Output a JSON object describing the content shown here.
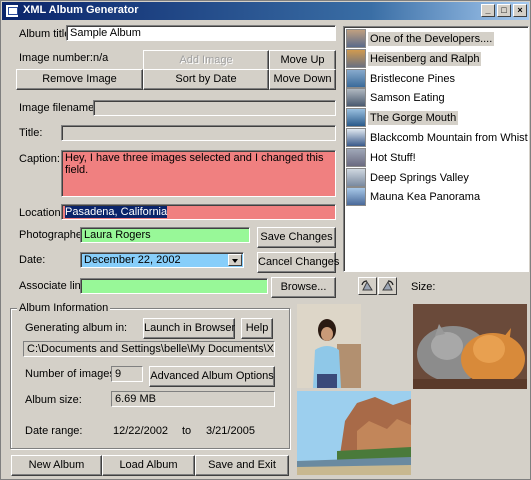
{
  "window": {
    "title": "XML Album Generator",
    "controls": {
      "minimize": "_",
      "maximize": "□",
      "close": "×"
    }
  },
  "form": {
    "album_title_label": "Album title:",
    "album_title_value": "Sample Album",
    "image_number_label": "Image number:",
    "image_number_value": "n/a",
    "image_filename_label": "Image filename:",
    "image_filename_value": "",
    "title_label": "Title:",
    "title_value": "",
    "caption_label": "Caption:",
    "caption_value": "Hey, I have three images selected and I changed this field.",
    "location_label": "Location:",
    "location_value": "Pasadena, California",
    "photographer_label": "Photographer:",
    "photographer_value": "Laura Rogers",
    "date_label": "Date:",
    "date_value": "December 22, 2002",
    "associate_link_label": "Associate link:",
    "associate_link_value": "",
    "size_label": "Size:"
  },
  "buttons": {
    "add_image": "Add Image",
    "move_up": "Move Up",
    "remove_image": "Remove Image",
    "sort_by_date": "Sort by Date",
    "move_down": "Move Down",
    "save_changes": "Save Changes",
    "cancel_changes": "Cancel Changes",
    "browse": "Browse...",
    "launch_in_browser": "Launch in Browser",
    "help": "Help",
    "advanced_album_options": "Advanced Album Options",
    "new_album": "New Album",
    "load_album": "Load Album",
    "save_and_exit": "Save and Exit"
  },
  "image_list": [
    {
      "label": "One of the Developers....",
      "selected": true
    },
    {
      "label": "Heisenberg and Ralph",
      "selected": true
    },
    {
      "label": "Bristlecone Pines",
      "selected": false
    },
    {
      "label": "Samson Eating",
      "selected": false
    },
    {
      "label": "The Gorge Mouth",
      "selected": true
    },
    {
      "label": "Blackcomb Mountain from Whistler ...",
      "selected": false
    },
    {
      "label": "Hot Stuff!",
      "selected": false
    },
    {
      "label": "Deep Springs Valley",
      "selected": false
    },
    {
      "label": "Mauna Kea Panorama",
      "selected": false
    }
  ],
  "album_info": {
    "legend": "Album Information",
    "generating_label": "Generating album in:",
    "path_value": "C:\\Documents and Settings\\belle\\My Documents\\XML Photo Alb",
    "num_images_label": "Number of images:",
    "num_images_value": "9",
    "album_size_label": "Album size:",
    "album_size_value": "6.69 MB",
    "date_range_label": "Date range:",
    "date_from": "12/22/2002",
    "date_to_word": "to",
    "date_to": "3/21/2005"
  },
  "colors": {
    "caption_bg": "#f08080",
    "location_bg": "#f08080",
    "photographer_bg": "#98f898",
    "date_bg": "#87cefa",
    "link_bg": "#98f898",
    "titlebar": "#0a246a"
  },
  "icons": [
    "rotate-left-icon",
    "rotate-right-icon",
    "combo-arrow-icon"
  ]
}
